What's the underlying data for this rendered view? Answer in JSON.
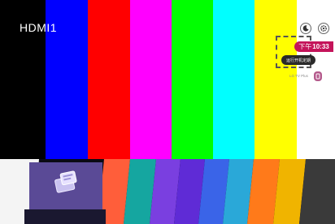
{
  "screen": {
    "source_title": "HDMI1",
    "test_pattern_colors": [
      "#000000",
      "#0000ff",
      "#ff0000",
      "#ff00ff",
      "#00ff00",
      "#00ffff",
      "#ffff00",
      "#ffffff"
    ]
  },
  "top_right": {
    "time_prefix": "下午",
    "time": "10:33",
    "schedule_label": "运行开机定期",
    "tv_plus_label": "LG TV Plus",
    "icons": [
      "moon-icon",
      "gear-icon",
      "accessory-icon"
    ]
  },
  "launcher": {
    "selected_tile_icon": "input-source-icon",
    "tile_colors": [
      "#ff5e3a",
      "#15a6a0",
      "#7a3fe0",
      "#5f2bd6",
      "#3a64e8",
      "#2aa8d8",
      "#ff7a1a",
      "#f0b400",
      "#3a3a3a"
    ]
  }
}
